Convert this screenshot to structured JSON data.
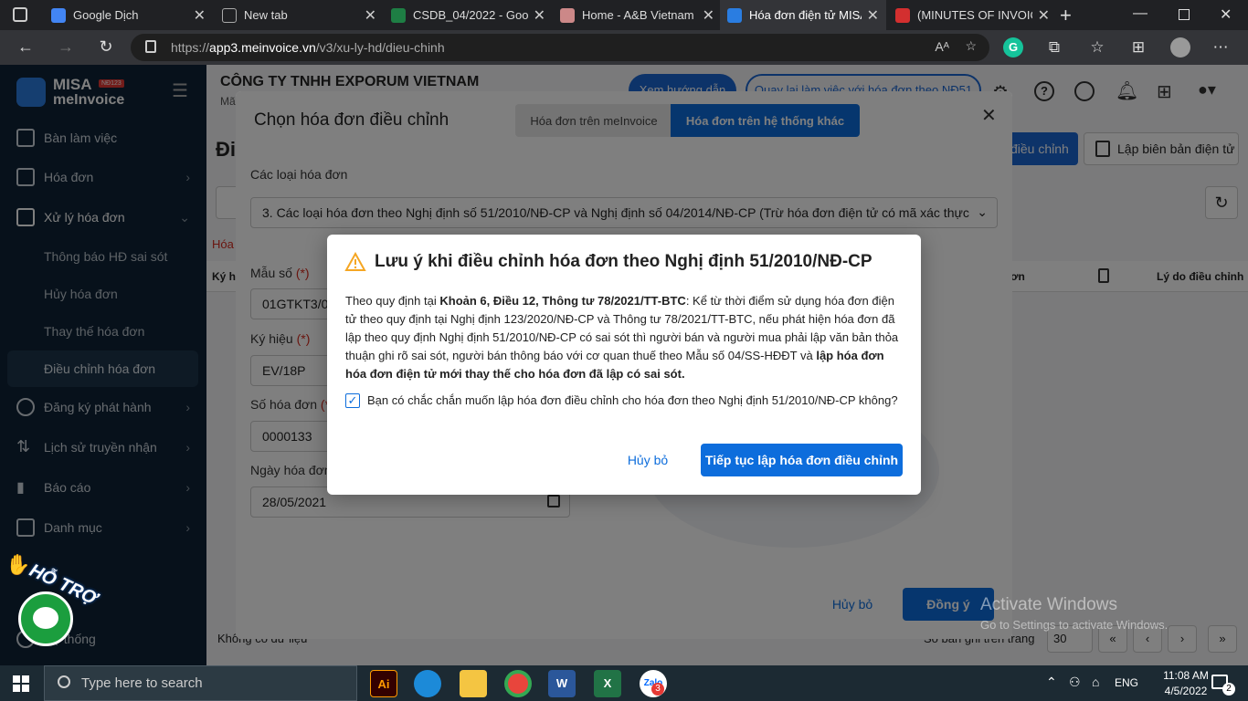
{
  "browser": {
    "tabs": [
      {
        "title": "Google Dịch",
        "color": "#4285f4"
      },
      {
        "title": "New tab",
        "color": "#555"
      },
      {
        "title": "CSDB_04/2022 - Goog",
        "color": "#1e7e44"
      },
      {
        "title": "Home - A&B Vietnam",
        "color": "#d04040"
      },
      {
        "title": "Hóa đơn điện tử MISA",
        "color": "#2a7de1"
      },
      {
        "title": "(MINUTES OF INVOICE",
        "color": "#d32f2f"
      }
    ],
    "url_prefix": "https://",
    "url_host": "app3.meinvoice.vn",
    "url_path": "/v3/xu-ly-hd/dieu-chinh"
  },
  "brand": {
    "name1": "MISA",
    "name2": "meInvoice",
    "badge": "NĐ123"
  },
  "sidebar": {
    "items": [
      {
        "label": "Bàn làm việc"
      },
      {
        "label": "Hóa đơn"
      },
      {
        "label": "Xử lý hóa đơn"
      },
      {
        "label": "Thông báo HĐ sai sót"
      },
      {
        "label": "Hủy hóa đơn"
      },
      {
        "label": "Thay thế hóa đơn"
      },
      {
        "label": "Điều chỉnh hóa đơn"
      },
      {
        "label": "Đăng ký phát hành"
      },
      {
        "label": "Lịch sử truyền nhận"
      },
      {
        "label": "Báo cáo"
      },
      {
        "label": "Danh mục"
      },
      {
        "label": "Hệ thống"
      }
    ],
    "support": "HỖ TRỢ"
  },
  "header": {
    "company": "CÔNG TY TNHH EXPORUM VIETNAM",
    "mst_prefix": "Mã",
    "guide_btn": "Xem hướng dẫn",
    "back_btn": "Quay lại làm việc với hóa đơn theo NĐ51"
  },
  "page": {
    "title_partial": "Đi",
    "adjust_btn_partial": "điều chỉnh",
    "minutes_btn": "Lập biên bản điện tử",
    "tab_partial": "Hóa",
    "col_left_partial": "Ký h",
    "col_right_partial": "ơn",
    "col_reason": "Lý do điều chỉnh",
    "no_data": "Không có dữ liệu",
    "per_page_label": "Số bản ghi trên trang",
    "per_page": "30"
  },
  "dialog": {
    "title": "Chọn hóa đơn điều chỉnh",
    "tab1": "Hóa đơn trên meInvoice",
    "tab2": "Hóa đơn trên hệ thống khác",
    "type_label": "Các loại hóa đơn",
    "type_value": "3. Các loại hóa đơn theo Nghị định số 51/2010/NĐ-CP và Nghị định số 04/2014/NĐ-CP (Trừ hóa đơn điện tử có mã xác thực của cơ q",
    "mau_so_label": "Mẫu số",
    "mau_so_value": "01GTKT3/0",
    "ky_hieu_label": "Ký hiệu",
    "ky_hieu_value": "EV/18P",
    "so_hd_label": "Số hóa đơn",
    "so_hd_value": "0000133",
    "ngay_label": "Ngày hóa đơn",
    "ngay_value": "28/05/2021",
    "req": "(*)",
    "cancel": "Hủy bỏ",
    "ok": "Đồng ý"
  },
  "alert": {
    "title": "Lưu ý khi điều chỉnh hóa đơn theo Nghị định 51/2010/NĐ-CP",
    "p1": "Theo quy định tại ",
    "p1_bold": "Khoản 6, Điều 12, Thông tư 78/2021/TT-BTC",
    "p2": ": Kể từ thời điểm sử dụng hóa đơn điện tử theo quy định tại Nghị định 123/2020/NĐ-CP và Thông tư 78/2021/TT-BTC, nếu phát hiện hóa đơn đã lập theo quy định Nghị định 51/2010/NĐ-CP có sai sót thì người bán và người mua phải lập văn bản thỏa thuận ghi rõ sai sót, người bán thông báo với cơ quan thuế theo Mẫu số 04/SS-HĐĐT và ",
    "p2_bold": "lập hóa đơn hóa đơn điện tử mới thay thế cho hóa đơn đã lập có sai sót.",
    "confirm": "Bạn có chắc chắn muốn lập hóa đơn điều chỉnh cho hóa đơn theo Nghị định 51/2010/NĐ-CP không?",
    "cancel": "Hủy bỏ",
    "continue": "Tiếp tục lập hóa đơn điều chỉnh"
  },
  "watermark": {
    "line1": "Activate Windows",
    "line2": "Go to Settings to activate Windows."
  },
  "taskbar": {
    "search_placeholder": "Type here to search",
    "lang": "ENG",
    "time": "11:08 AM",
    "date": "4/5/2022",
    "notif_count": "2",
    "zalo_badge": "3"
  },
  "colors": {
    "accent": "#0d6ddc",
    "sidebar": "#0e2336",
    "warning": "#f5a623"
  }
}
